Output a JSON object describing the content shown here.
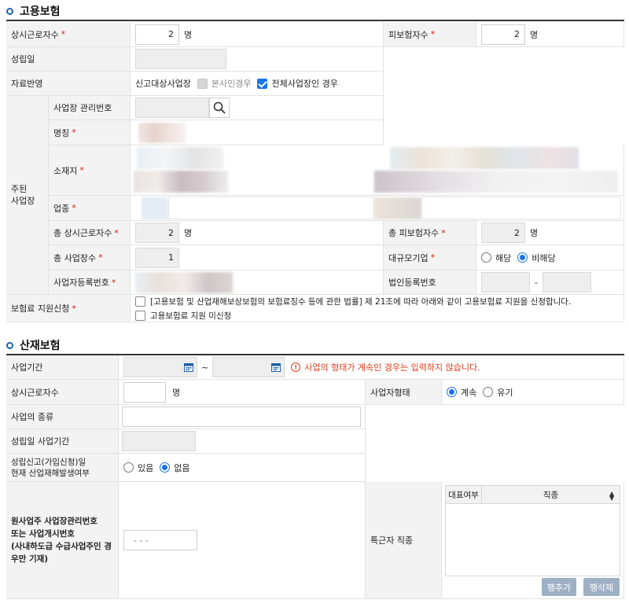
{
  "employment": {
    "title": "고용보험",
    "workers_label": "상시근로자수",
    "workers_value": "2",
    "insured_label": "피보험자수",
    "insured_value": "2",
    "unit": "명",
    "founding_label": "성립일",
    "reflect_label": "자료반영",
    "reflect_prefix": "신고대상사업장",
    "reflect_opt1": "본사인경우",
    "reflect_opt2": "전체사업장인 경우",
    "main_site_label": "주된\n사업장",
    "mgmt_no_label": "사업장 관리번호",
    "name_label": "명칭",
    "address_label": "소재지",
    "industry_label": "업종",
    "total_workers_label": "총 상시근로자수",
    "total_workers_value": "2",
    "total_insured_label": "총 피보험자수",
    "total_insured_value": "2",
    "total_sites_label": "총 사업장수",
    "total_sites_value": "1",
    "large_company_label": "대규모기업",
    "large_yes": "해당",
    "large_no": "비해당",
    "biz_reg_label": "사업자등록번호",
    "corp_reg_label": "법인등록번호",
    "corp_reg_sep": "-",
    "support_label": "보험료 지원신청",
    "support_opt1": "[고용보험 및 산업재해보상보험의 보험료징수 등에 관한 법률] 제 21조에 따라 아래와 같이 고용보험료 지원을 신청합니다.",
    "support_opt2": "고용보험료 지원 미신청"
  },
  "industrial": {
    "title": "산재보험",
    "period_label": "사업기간",
    "period_sep": "~",
    "period_alert": "사업의 형태가 계속인 경우는 입력하지 않습니다.",
    "workers_label": "상시근로자수",
    "unit": "명",
    "biz_form_label": "사업자형태",
    "form_continue": "계속",
    "form_fixed": "유기",
    "biz_type_label": "사업의 종류",
    "founding_period_label": "성립일 사업기간",
    "accident_label": "성립신고(가입신청)일\n현재 산업재해발생여부",
    "accident_yes": "있음",
    "accident_no": "없음",
    "prime_label": "원사업주 사업장관리번호\n또는 사업개시번호\n(사내하도급 수급사업주인 경\n우만 기재)",
    "prime_placeholder": "- -  -",
    "special_label": "특근자 직종",
    "grid_col1": "대표여부",
    "grid_col2": "직종",
    "add_row": "행추가",
    "del_row": "행삭제"
  },
  "colors": {
    "accent": "#1a73e8",
    "required": "#d81b1b",
    "alert": "#e03c1c",
    "button": "#9eb0c4"
  }
}
